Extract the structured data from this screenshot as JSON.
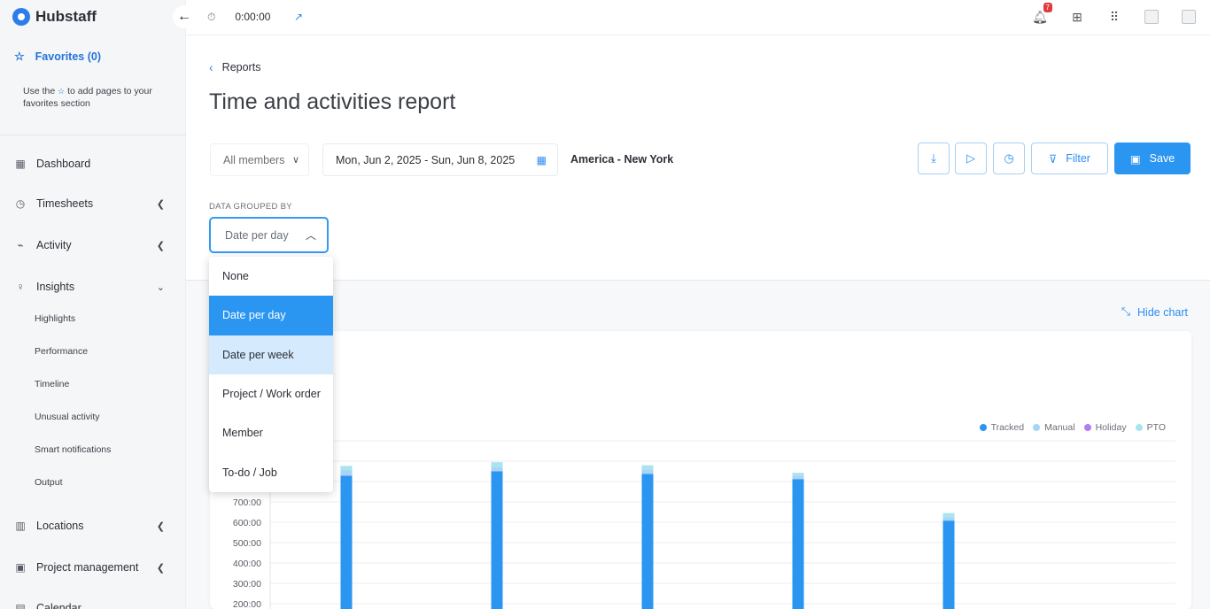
{
  "app": {
    "name": "Hubstaff"
  },
  "sidebar": {
    "favorites_label": "Favorites (0)",
    "favorites_help_before": "Use the",
    "favorites_help_after": "to add pages to your favorites section",
    "items": [
      {
        "label": "Dashboard",
        "icon": "dashboard-icon"
      },
      {
        "label": "Timesheets",
        "icon": "clock-icon"
      },
      {
        "label": "Activity",
        "icon": "activity-icon"
      },
      {
        "label": "Insights",
        "icon": "lightbulb-icon"
      },
      {
        "label": "Locations",
        "icon": "map-icon"
      },
      {
        "label": "Project management",
        "icon": "clipboard-icon"
      },
      {
        "label": "Calendar",
        "icon": "calendar-icon"
      }
    ],
    "insights_sub": [
      "Highlights",
      "Performance",
      "Timeline",
      "Unusual activity",
      "Smart notifications",
      "Output"
    ]
  },
  "topbar": {
    "timer_value": "0:00:00",
    "notification_count": "7"
  },
  "header": {
    "breadcrumb": "Reports",
    "title": "Time and activities report",
    "members_label": "All members",
    "date_range": "Mon, Jun 2, 2025 - Sun, Jun 8, 2025",
    "timezone": "America - New York",
    "filter_label": "Filter",
    "save_label": "Save",
    "group_label": "DATA GROUPED BY",
    "group_value": "Date per day"
  },
  "group_options": [
    {
      "label": "None"
    },
    {
      "label": "Date per day"
    },
    {
      "label": "Date per week"
    },
    {
      "label": "Project / Work order"
    },
    {
      "label": "Member"
    },
    {
      "label": "To-do / Job"
    }
  ],
  "group_selected": "Date per day",
  "group_hovered": "Date per week",
  "chart": {
    "hide_label": "Hide chart"
  },
  "colors": {
    "tracked": "#2b95f2",
    "manual": "#a8d4f6",
    "holiday": "#b57bf0",
    "pto": "#a9e4ef",
    "accent": "#2b95f2"
  },
  "chart_data": {
    "type": "bar",
    "stacked": true,
    "categories": [
      "",
      "",
      "",
      "",
      ""
    ],
    "series": [
      {
        "name": "Tracked",
        "values": [
          829,
          850,
          837,
          812,
          608
        ]
      },
      {
        "name": "Manual",
        "values": [
          28,
          22,
          23,
          17,
          17
        ]
      },
      {
        "name": "Holiday",
        "values": [
          0,
          0,
          0,
          0,
          0
        ]
      },
      {
        "name": "PTO",
        "values": [
          20,
          23,
          20,
          14,
          20
        ]
      }
    ],
    "yticks": [
      "200:00",
      "300:00",
      "400:00",
      "500:00",
      "600:00",
      "700:00"
    ],
    "ylim": [
      200,
      1000
    ],
    "legend_position": "top-right",
    "grid": true
  }
}
